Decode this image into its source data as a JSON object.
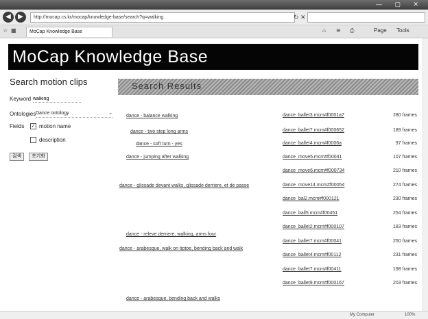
{
  "browser": {
    "url": "http://mocap.cs.kr/mocap/knowledge-base/search?q=walking",
    "tab_title": "MoCap Knowledge Base",
    "tab_controls": [
      "Page",
      "Tools"
    ],
    "status_zone": "My Computer",
    "zoom": "100%"
  },
  "page": {
    "title": "MoCap Knowledge Base",
    "sidebar": {
      "heading": "Search motion clips",
      "keyword_label": "Keyword",
      "keyword_value": "walking",
      "ontologies_label": "Ontologies",
      "ontologies_value": "Dance ontology",
      "fields_label": "Fields",
      "field_motion_name": "motion name",
      "field_description": "description",
      "buttons": [
        "검색",
        "초기화"
      ]
    },
    "search_header": "Search Results"
  },
  "results_left": [
    {
      "text": "dance - balance walking"
    },
    {
      "text": "dance - two step long arms"
    },
    {
      "text": "dance - soft turn - yes"
    },
    {
      "text": "dance - jumping after walking"
    },
    {
      "text": "dance - glissade devant walks, glissade derriere, et de passe"
    },
    {
      "text": "dance - releve derriere, walking, arms four"
    },
    {
      "text": "dance - arabesque, walk on tiptoe, bending back and walk"
    },
    {
      "text": "dance - arabesque, bending back and walks"
    }
  ],
  "results_right": [
    {
      "link": "dance_ballet3.mcm#f0001a7",
      "frames": "280 frames"
    },
    {
      "link": "dance_ballet7.mcm#f000652",
      "frames": "189 frames"
    },
    {
      "link": "dance_ballet4.mcm#f0006a",
      "frames": "97 frames"
    },
    {
      "link": "dance_move5.mcm#f00041",
      "frames": "107 frames"
    },
    {
      "link": "dance_move6.mcm#f000734",
      "frames": "210 frames"
    },
    {
      "link": "dance_move14.mcm#f00054",
      "frames": "274 frames"
    },
    {
      "link": "dance_bal2.mcm#f000121",
      "frames": "230 frames"
    },
    {
      "link": "dance_ball5.mcm#f00451",
      "frames": "254 frames"
    },
    {
      "link": "dance_ballet2.mcm#f000107",
      "frames": "183 frames"
    },
    {
      "link": "dance_ballet7.mcm#f00041",
      "frames": "250 frames"
    },
    {
      "link": "dance_ballet4.mcm#f00112",
      "frames": "231 frames"
    },
    {
      "link": "dance_ballet7.mcm#f00411",
      "frames": "198 frames"
    },
    {
      "link": "dance_ballet9.mcm#f000167",
      "frames": "203 frames"
    }
  ]
}
